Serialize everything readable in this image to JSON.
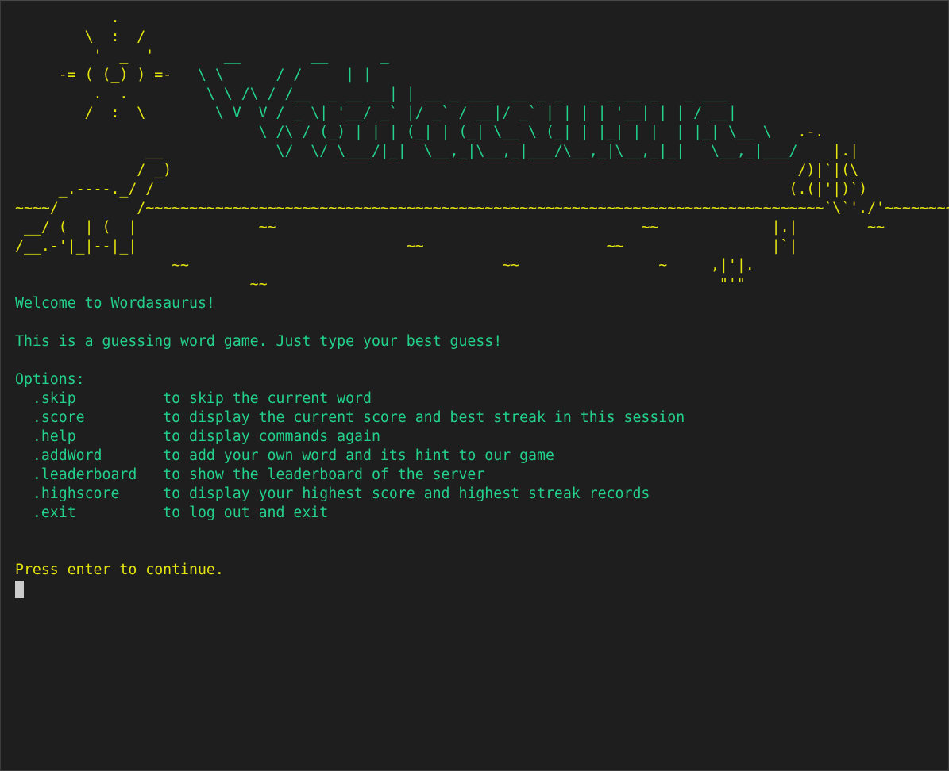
{
  "colors": {
    "background": "#1e1e1e",
    "ascii_yellow": "#e5e510",
    "text_green": "#23d18b",
    "cursor": "#cccccc"
  },
  "banner": {
    "lines": [
      [
        [
          "y",
          "           .                                                                                     "
        ]
      ],
      [
        [
          "y",
          "        \\  :  /                                                                                   "
        ]
      ],
      [
        [
          "y",
          "         '  _  '        "
        ],
        [
          "g",
          "__        __      _"
        ]
      ],
      [
        [
          "y",
          "     -= ( (_) ) =-  "
        ],
        [
          "g",
          " \\ \\      / /     | |"
        ]
      ],
      [
        [
          "y",
          "         .  .        "
        ],
        [
          "g",
          " \\ \\ /\\ / /__  _ __ __| | __ _ ___  __ _ _   _ _ __ _   _ ___"
        ]
      ],
      [
        [
          "y",
          "        /  :  \\      "
        ],
        [
          "g",
          "  \\ V  V / _ \\| '__/ _` |/ _` / __|/ _` | | | | '__| | | / __|"
        ]
      ],
      [
        [
          "g",
          "                            \\ /\\ / (_) | | | (_| | (_| \\__ \\ (_| | |_| | |  | |_| \\__ \\"
        ],
        [
          "y",
          "   .-."
        ]
      ],
      [
        [
          "y",
          "               __             "
        ],
        [
          "g",
          "\\/  \\/ \\___/|_|  \\__,_|\\__,_|___/\\__,_|\\__,_|_|   \\__,_|___/"
        ],
        [
          "y",
          "    |.|"
        ]
      ],
      [
        [
          "y",
          "              / _)                                                                        /)|`|(\\"
        ]
      ],
      [
        [
          "y",
          "     _.----._/ /                                                                         (.(|'|)`)"
        ]
      ],
      [
        [
          "y",
          "~~~~/         /~~~~~~~~~~~~~~~~~~~~~~~~~~~~~~~~~~~~~~~~~~~~~~~~~~~~~~~~~~~~~~~~~~~~~~~~~~~~~~`\\`'./'~~~~~~~~"
        ]
      ],
      [
        [
          "y",
          " __/ (  | (  |              ~~                                          ~~             |.|        ~~"
        ]
      ],
      [
        [
          "y",
          "/__.-'|_|--|_|                               ~~                     ~~                 |`|"
        ]
      ],
      [
        [
          "y",
          "                  ~~                                    ~~                ~     ,|'|."
        ]
      ],
      [
        [
          "y",
          "                           ~~                                                    \"'\""
        ]
      ]
    ]
  },
  "messages": {
    "welcome": "Welcome to Wordasaurus!",
    "intro": "This is a guessing word game. Just type your best guess!",
    "options_header": "Options:",
    "prompt": "Press enter to continue."
  },
  "options": [
    {
      "command": "  .skip          ",
      "description": "to skip the current word"
    },
    {
      "command": "  .score         ",
      "description": "to display the current score and best streak in this session"
    },
    {
      "command": "  .help          ",
      "description": "to display commands again"
    },
    {
      "command": "  .addWord       ",
      "description": "to add your own word and its hint to our game"
    },
    {
      "command": "  .leaderboard   ",
      "description": "to show the leaderboard of the server"
    },
    {
      "command": "  .highscore     ",
      "description": "to display your highest score and highest streak records"
    },
    {
      "command": "  .exit          ",
      "description": "to log out and exit"
    }
  ]
}
